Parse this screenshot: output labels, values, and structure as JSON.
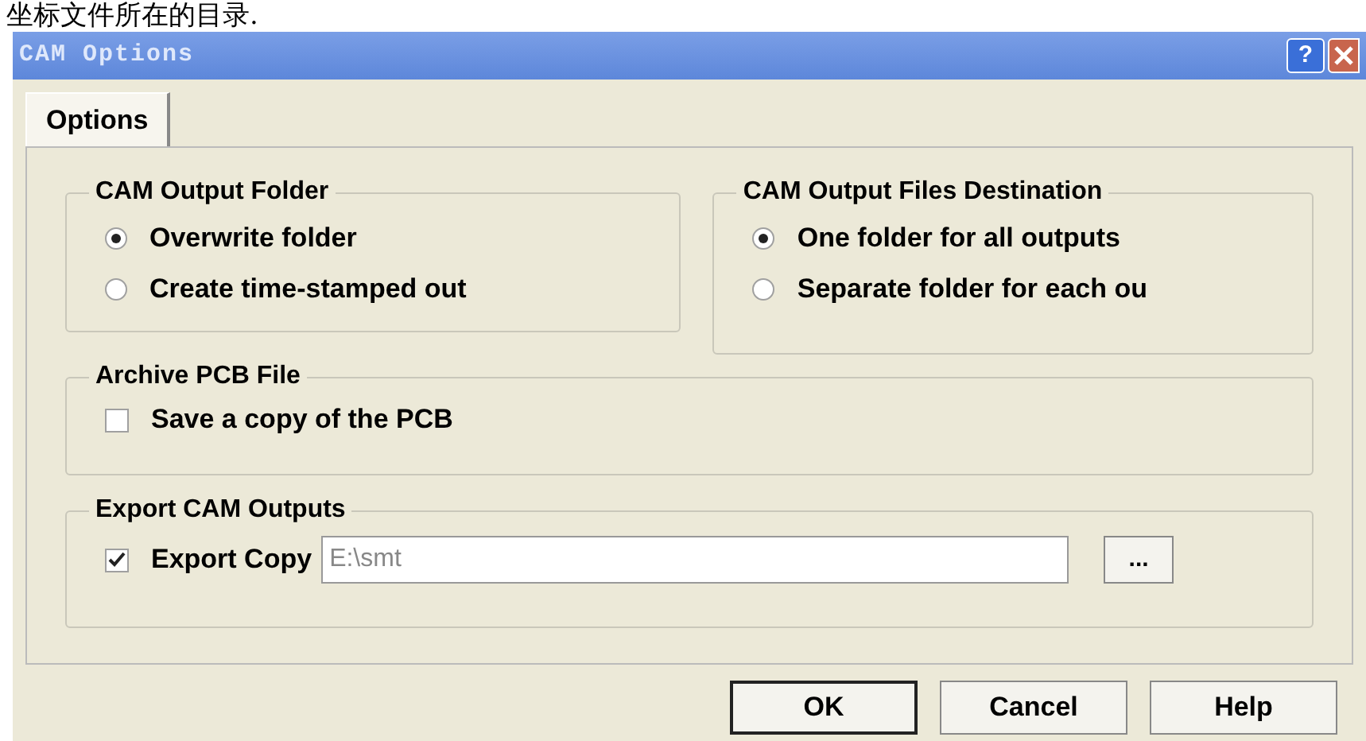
{
  "caption": "坐标文件所在的目录.",
  "window": {
    "title": "CAM Options",
    "help_button": "?"
  },
  "tabs": [
    {
      "label": "Options",
      "selected": true
    }
  ],
  "groups": [
    {
      "title": "CAM Output Folder",
      "kind": "radio",
      "options": [
        {
          "label": "Overwrite folder",
          "selected": true
        },
        {
          "label": "Create time-stamped out",
          "selected": false
        }
      ]
    },
    {
      "title": "CAM Output Files Destination",
      "kind": "radio",
      "options": [
        {
          "label": "One folder for all outputs",
          "selected": true
        },
        {
          "label": "Separate folder for each ou",
          "selected": false
        }
      ]
    },
    {
      "title": "Archive PCB File",
      "kind": "checkbox",
      "options": [
        {
          "label": "Save a copy of the PCB",
          "checked": false
        }
      ]
    },
    {
      "title": "Export CAM Outputs",
      "kind": "path",
      "options": [
        {
          "label": "Export Copy",
          "checked": true,
          "value": "E:\\smt",
          "browse": "..."
        }
      ]
    }
  ],
  "buttons": [
    "OK",
    "Cancel",
    "Help"
  ]
}
